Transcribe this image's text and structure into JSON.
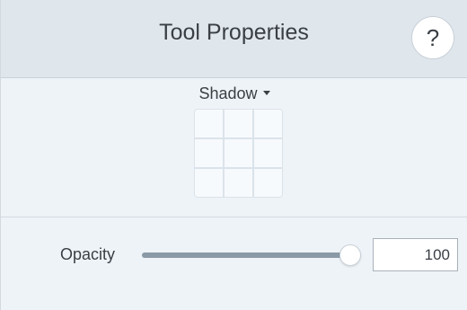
{
  "header": {
    "title": "Tool Properties",
    "help_label": "?"
  },
  "shadow": {
    "label": "Shadow",
    "icon": "chevron-down-icon",
    "grid_cells": 9
  },
  "opacity": {
    "label": "Opacity",
    "value": "100",
    "fraction": 1.0
  },
  "colors": {
    "header_bg": "#dfe6ec",
    "panel_bg": "#eef3f8",
    "slider_fill": "#8a9aa6",
    "text": "#3a3f45"
  }
}
